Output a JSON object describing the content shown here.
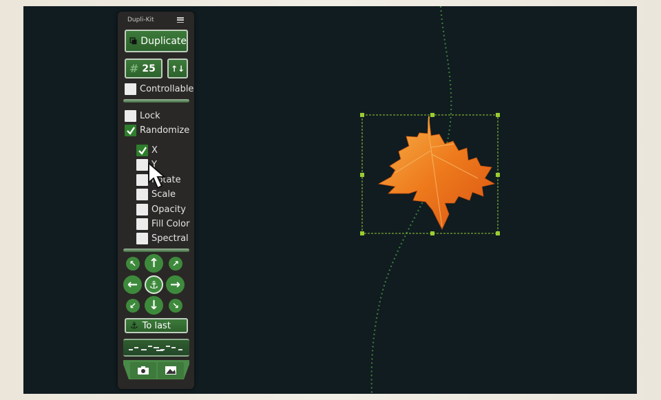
{
  "panel": {
    "title": "Dupli-Kit",
    "menu_icon": "hamburger-icon",
    "duplicate_label": "Duplicate",
    "count_prefix": "#",
    "count_value": "25",
    "updown_label": "↑↓",
    "controllable_label": "Controllable",
    "lock_label": "Lock",
    "randomize_label": "Randomize",
    "random_options": [
      {
        "label": "X",
        "checked": true
      },
      {
        "label": "Y",
        "checked": false
      },
      {
        "label": "Rotate",
        "checked": false
      },
      {
        "label": "Scale",
        "checked": false
      },
      {
        "label": "Opacity",
        "checked": false
      },
      {
        "label": "Fill Color",
        "checked": false
      },
      {
        "label": "Spectral",
        "checked": false
      }
    ],
    "to_last_label": "To last",
    "colors": {
      "accent_green": "#3e8a3c",
      "panel_bg": "#2a2826",
      "canvas_bg": "#101c20",
      "selection": "#9acd32"
    }
  },
  "canvas": {
    "object": "maple-leaf",
    "selected": true
  }
}
